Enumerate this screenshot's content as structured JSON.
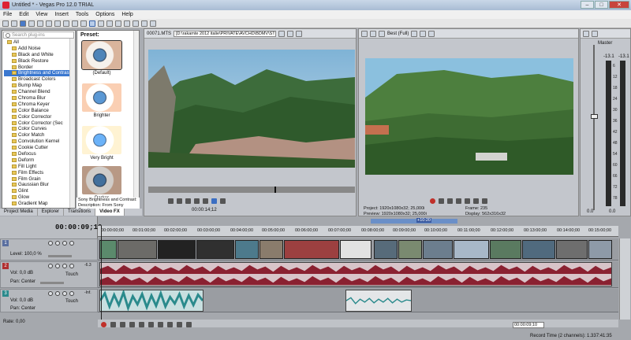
{
  "window": {
    "title": "Untitled * - Vegas Pro 12.0 TRIAL",
    "min": "–",
    "max": "□",
    "close": "✕"
  },
  "menu": [
    "File",
    "Edit",
    "View",
    "Insert",
    "Tools",
    "Options",
    "Help"
  ],
  "fx": {
    "search_placeholder": "Search plug-ins",
    "items": [
      "All",
      "Add Noise",
      "Black and White",
      "Black Restore",
      "Border",
      "Brightness and Contrast",
      "Broadcast Colors",
      "Bump Map",
      "Channel Blend",
      "Chroma Blur",
      "Chroma Keyer",
      "Color Balance",
      "Color Corrector",
      "Color Corrector (Sec",
      "Color Curves",
      "Color Match",
      "Convolution Kernel",
      "Cookie Cutter",
      "Defocus",
      "Deform",
      "Fill Light",
      "Film Effects",
      "Film Grain",
      "Gaussian Blur",
      "Glint",
      "Glow",
      "Gradient Map"
    ],
    "selected_index": 5,
    "preset_label": "Preset:",
    "presets": [
      "(Default)",
      "Brighter",
      "Very Bright",
      "Darker"
    ],
    "description": "Sony Brightness and Contrast: Description: From Sony Creative",
    "tabs": [
      "Project Media",
      "Explorer",
      "Transitions",
      "Video FX"
    ],
    "active_tab": "Video FX"
  },
  "trimmer": {
    "filename": "00071.MTS",
    "path": "[D:\\rakamte 2012 italie\\PRIVATE\\AVCHD\\BDMV\\STREAM\\]",
    "time": "00:00:14;12"
  },
  "preview": {
    "quality": "Best (Full)",
    "project_label": "Project:",
    "project": "1920x1080x32; 25,000i",
    "preview_label": "Preview:",
    "preview": "1920x1080x32; 25,000i",
    "frame_label": "Frame:",
    "frame": "235",
    "display_label": "Display:",
    "display": "562x316x32"
  },
  "master": {
    "label": "Master",
    "peak_left": "-13.1",
    "peak_right": "-13.1",
    "scale": [
      "6",
      "12",
      "18",
      "24",
      "30",
      "36",
      "42",
      "48",
      "54",
      "60",
      "66",
      "72",
      "78",
      "84"
    ],
    "val_left": "0.0",
    "val_right": "0.0",
    "level": 0.0
  },
  "timeline": {
    "timecode": "00:00:09;10",
    "ruler": [
      "00:00:00;00",
      "00:01:00;00",
      "00:02:00;00",
      "00:03:00;00",
      "00:04:00;00",
      "00:05:00;00",
      "00:06:00;00",
      "00:07:00;00",
      "00:08:00;00",
      "00:09:00;00",
      "00:10:00;00",
      "00:11:00;00",
      "00:12:00;00",
      "00:13:00;00",
      "00:14:00;00",
      "00:15:00;00"
    ],
    "region": "+10:20",
    "video_track": {
      "num": "1",
      "level_label": "Level:",
      "level": "100,0 %"
    },
    "audio_track": {
      "num": "2",
      "vol_label": "Vol:",
      "vol": "0,0 dB",
      "pan_label": "Pan:",
      "pan": "Center",
      "mode": "Touch",
      "db": "-6.3"
    },
    "audio_track2": {
      "num": "3",
      "vol_label": "Vol:",
      "vol": "0,0 dB",
      "pan_label": "Pan:",
      "pan": "Center",
      "mode": "Touch",
      "db": "-Inf."
    },
    "rate_label": "Rate:",
    "rate": "0,00",
    "bottom_time": "00:00:09;10",
    "status": "Record Time (2 channels): 1.337:41:35"
  },
  "colors": {
    "selection": "#3b78d0",
    "audio_wave": "#8a2131",
    "audio_wave2": "#2a8a8c",
    "accent": "#c0302a"
  }
}
